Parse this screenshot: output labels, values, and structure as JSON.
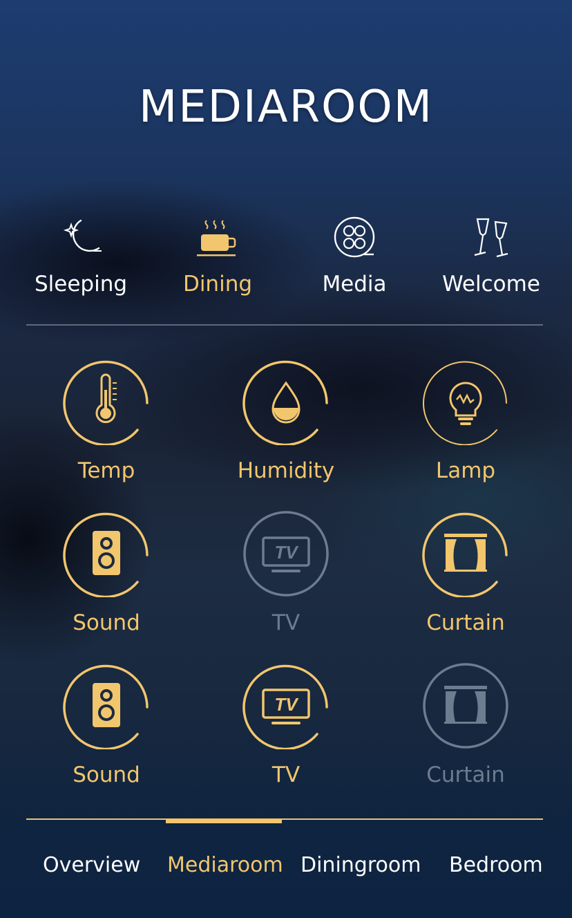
{
  "header": {
    "title": "MEDIAROOM"
  },
  "scenes": [
    {
      "label": "Sleeping",
      "icon": "moon-stars-icon",
      "active": false
    },
    {
      "label": "Dining",
      "icon": "coffee-cup-icon",
      "active": true
    },
    {
      "label": "Media",
      "icon": "film-reel-icon",
      "active": false
    },
    {
      "label": "Welcome",
      "icon": "champagne-glasses-icon",
      "active": false
    }
  ],
  "devices": [
    {
      "label": "Temp",
      "icon": "thermometer-icon",
      "state": "on"
    },
    {
      "label": "Humidity",
      "icon": "water-drop-icon",
      "state": "on"
    },
    {
      "label": "Lamp",
      "icon": "light-bulb-icon",
      "state": "on"
    },
    {
      "label": "Sound",
      "icon": "speaker-icon",
      "state": "on"
    },
    {
      "label": "TV",
      "icon": "tv-icon",
      "state": "off"
    },
    {
      "label": "Curtain",
      "icon": "curtain-icon",
      "state": "on"
    },
    {
      "label": "Sound",
      "icon": "speaker-icon",
      "state": "on"
    },
    {
      "label": "TV",
      "icon": "tv-icon",
      "state": "on"
    },
    {
      "label": "Curtain",
      "icon": "curtain-icon",
      "state": "off"
    }
  ],
  "tabs": [
    {
      "label": "Overview",
      "active": false
    },
    {
      "label": "Mediaroom",
      "active": true
    },
    {
      "label": "Diningroom",
      "active": false
    },
    {
      "label": "Bedroom",
      "active": false
    }
  ],
  "colors": {
    "accent": "#f2c66d",
    "inactive": "#6d7c8f",
    "text": "#ffffff"
  }
}
